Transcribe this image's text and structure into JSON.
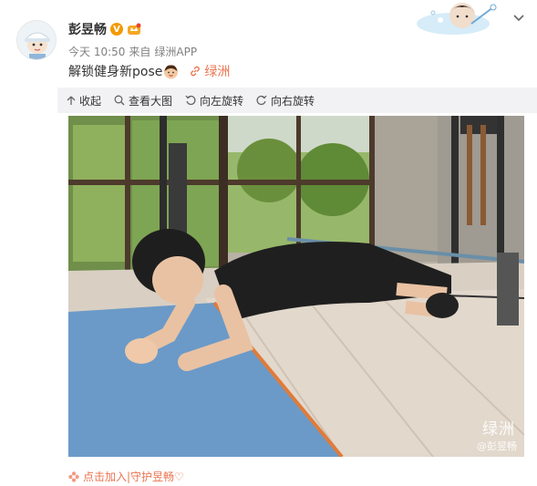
{
  "post": {
    "author": "彭昱畅",
    "time": "今天 10:50",
    "source_prefix": "来自",
    "source": "绿洲APP",
    "text": "解锁健身新pose",
    "link_label": "绿洲"
  },
  "toolbar": {
    "collapse": "收起",
    "view_large": "查看大图",
    "rotate_left": "向左旋转",
    "rotate_right": "向右旋转"
  },
  "photo": {
    "watermark_brand": "绿洲",
    "watermark_user": "@彭昱畅"
  },
  "footer": {
    "text": "点击加入|守护昱畅♡"
  },
  "colors": {
    "accent": "#eb7350",
    "badge": "#f29a00",
    "mat": "#6b9ac8"
  },
  "icons": [
    "verified-v-icon",
    "crown-icon",
    "link-icon",
    "collapse-icon",
    "zoom-icon",
    "rotate-left-icon",
    "rotate-right-icon",
    "chevron-down-icon",
    "flower-icon"
  ]
}
